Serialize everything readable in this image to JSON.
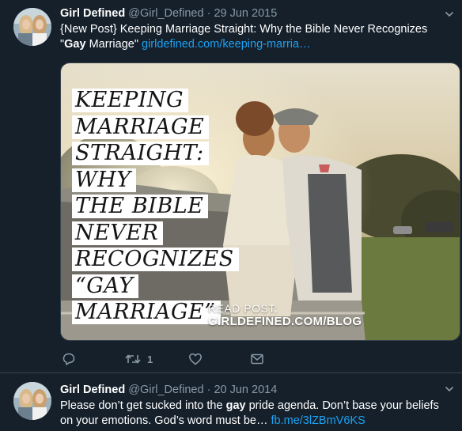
{
  "colors": {
    "background": "#15202b",
    "border": "#38444d",
    "text_secondary": "#8899a6",
    "link": "#1da1f2"
  },
  "tweets": [
    {
      "author": {
        "name": "Girl Defined",
        "handle": "@Girl_Defined"
      },
      "separator": "·",
      "date": "29 Jun 2015",
      "text_before": "{New Post} Keeping Marriage Straight: Why the Bible Never Recognizes \"",
      "text_bold": "Gay",
      "text_after": " Marriage\" ",
      "link": "girldefined.com/keeping-marria…",
      "media": {
        "title_lines": [
          "Keeping",
          "Marriage",
          "Straight:",
          "Why",
          "The Bible",
          "Never",
          "Recognizes",
          "“Gay",
          "Marriage”"
        ],
        "read_post_label": "READ POST:",
        "read_post_url": "GIRLDEFINED.COM/BLOG"
      },
      "actions": {
        "reply_icon": "reply-icon",
        "retweet_icon": "retweet-icon",
        "retweet_count": "1",
        "like_icon": "heart-icon",
        "dm_icon": "mail-icon"
      }
    },
    {
      "author": {
        "name": "Girl Defined",
        "handle": "@Girl_Defined"
      },
      "separator": "·",
      "date": "20 Jun 2014",
      "text_before": "Please don’t get sucked into the ",
      "text_bold": "gay",
      "text_after": " pride agenda. Don’t base your beliefs on your emotions. God’s word must be… ",
      "link": "fb.me/3lZBmV6KS"
    }
  ]
}
